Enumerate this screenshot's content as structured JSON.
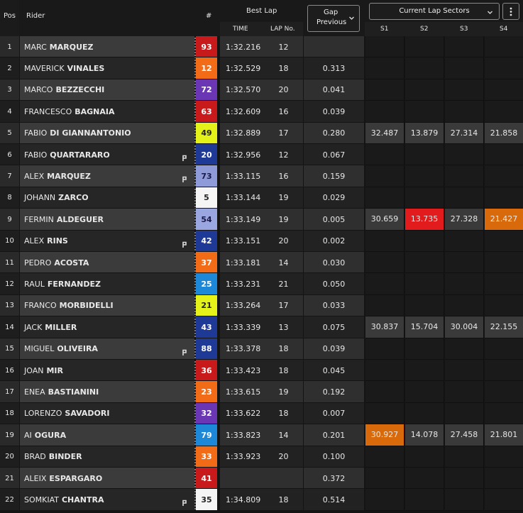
{
  "header": {
    "pos": "Pos",
    "rider": "Rider",
    "num": "#",
    "best_lap": "Best Lap",
    "time": "TIME",
    "lap_no": "LAP No.",
    "gap_previous": [
      "Gap",
      "Previous"
    ],
    "current_lap_sectors": "Current Lap Sectors",
    "sectors": [
      "S1",
      "S2",
      "S3",
      "S4"
    ]
  },
  "colors": {
    "sector_best_red": "#e21c1c",
    "sector_personal_orange": "#d96a0c"
  },
  "riders": [
    {
      "pos": "1",
      "first": "MARC",
      "last": "MARQUEZ",
      "num": "93",
      "num_bg": "#c8191b",
      "num_fg": "#ffffff",
      "time": "1:32.216",
      "lap": "12",
      "gap": "",
      "pit": false,
      "sectors": []
    },
    {
      "pos": "2",
      "first": "MAVERICK",
      "last": "VINALES",
      "num": "12",
      "num_bg": "#f26b16",
      "num_fg": "#ffffff",
      "time": "1:32.529",
      "lap": "18",
      "gap": "0.313",
      "pit": false,
      "sectors": []
    },
    {
      "pos": "3",
      "first": "MARCO",
      "last": "BEZZECCHI",
      "num": "72",
      "num_bg": "#6a36b4",
      "num_fg": "#ffffff",
      "time": "1:32.570",
      "lap": "20",
      "gap": "0.041",
      "pit": false,
      "sectors": []
    },
    {
      "pos": "4",
      "first": "FRANCESCO",
      "last": "BAGNAIA",
      "num": "63",
      "num_bg": "#c8191b",
      "num_fg": "#ffffff",
      "time": "1:32.609",
      "lap": "16",
      "gap": "0.039",
      "pit": false,
      "sectors": []
    },
    {
      "pos": "5",
      "first": "FABIO",
      "last": "DI GIANNANTONIO",
      "num": "49",
      "num_bg": "#e4f21a",
      "num_fg": "#222222",
      "time": "1:32.889",
      "lap": "17",
      "gap": "0.280",
      "pit": false,
      "sectors": [
        "32.487",
        "13.879",
        "27.314",
        "21.858"
      ],
      "sector_colors": [
        "",
        "",
        "",
        ""
      ]
    },
    {
      "pos": "6",
      "first": "FABIO",
      "last": "QUARTARARO",
      "num": "20",
      "num_bg": "#1f3a96",
      "num_fg": "#ffffff",
      "time": "1:32.956",
      "lap": "12",
      "gap": "0.067",
      "pit": true,
      "sectors": []
    },
    {
      "pos": "7",
      "first": "ALEX",
      "last": "MARQUEZ",
      "num": "73",
      "num_bg": "#8f9ad8",
      "num_fg": "#1a1a4a",
      "time": "1:33.115",
      "lap": "16",
      "gap": "0.159",
      "pit": true,
      "sectors": []
    },
    {
      "pos": "8",
      "first": "JOHANN",
      "last": "ZARCO",
      "num": "5",
      "num_bg": "#f4f4f4",
      "num_fg": "#222222",
      "time": "1:33.144",
      "lap": "19",
      "gap": "0.029",
      "pit": false,
      "sectors": []
    },
    {
      "pos": "9",
      "first": "FERMIN",
      "last": "ALDEGUER",
      "num": "54",
      "num_bg": "#9aa6e0",
      "num_fg": "#1a1a4a",
      "time": "1:33.149",
      "lap": "19",
      "gap": "0.005",
      "pit": false,
      "sectors": [
        "30.659",
        "13.735",
        "27.328",
        "21.427"
      ],
      "sector_colors": [
        "",
        "#e21c1c",
        "",
        "#d96a0c"
      ]
    },
    {
      "pos": "10",
      "first": "ALEX",
      "last": "RINS",
      "num": "42",
      "num_bg": "#1f3a96",
      "num_fg": "#ffffff",
      "time": "1:33.151",
      "lap": "20",
      "gap": "0.002",
      "pit": true,
      "sectors": []
    },
    {
      "pos": "11",
      "first": "PEDRO",
      "last": "ACOSTA",
      "num": "37",
      "num_bg": "#f26b16",
      "num_fg": "#ffffff",
      "time": "1:33.181",
      "lap": "14",
      "gap": "0.030",
      "pit": false,
      "sectors": []
    },
    {
      "pos": "12",
      "first": "RAUL",
      "last": "FERNANDEZ",
      "num": "25",
      "num_bg": "#1e88d8",
      "num_fg": "#ffffff",
      "time": "1:33.231",
      "lap": "21",
      "gap": "0.050",
      "pit": false,
      "sectors": []
    },
    {
      "pos": "13",
      "first": "FRANCO",
      "last": "MORBIDELLI",
      "num": "21",
      "num_bg": "#e4f21a",
      "num_fg": "#222222",
      "time": "1:33.264",
      "lap": "17",
      "gap": "0.033",
      "pit": false,
      "sectors": []
    },
    {
      "pos": "14",
      "first": "JACK",
      "last": "MILLER",
      "num": "43",
      "num_bg": "#1f3a96",
      "num_fg": "#ffffff",
      "time": "1:33.339",
      "lap": "13",
      "gap": "0.075",
      "pit": false,
      "sectors": [
        "30.837",
        "15.704",
        "30.004",
        "22.155"
      ],
      "sector_colors": [
        "",
        "",
        "",
        ""
      ]
    },
    {
      "pos": "15",
      "first": "MIGUEL",
      "last": "OLIVEIRA",
      "num": "88",
      "num_bg": "#1f3a96",
      "num_fg": "#ffffff",
      "time": "1:33.378",
      "lap": "18",
      "gap": "0.039",
      "pit": true,
      "sectors": []
    },
    {
      "pos": "16",
      "first": "JOAN",
      "last": "MIR",
      "num": "36",
      "num_bg": "#c8191b",
      "num_fg": "#ffffff",
      "time": "1:33.423",
      "lap": "18",
      "gap": "0.045",
      "pit": false,
      "sectors": []
    },
    {
      "pos": "17",
      "first": "ENEA",
      "last": "BASTIANINI",
      "num": "23",
      "num_bg": "#f26b16",
      "num_fg": "#ffffff",
      "time": "1:33.615",
      "lap": "19",
      "gap": "0.192",
      "pit": false,
      "sectors": []
    },
    {
      "pos": "18",
      "first": "LORENZO",
      "last": "SAVADORI",
      "num": "32",
      "num_bg": "#6a36b4",
      "num_fg": "#ffffff",
      "time": "1:33.622",
      "lap": "18",
      "gap": "0.007",
      "pit": false,
      "sectors": []
    },
    {
      "pos": "19",
      "first": "AI",
      "last": "OGURA",
      "num": "79",
      "num_bg": "#1e88d8",
      "num_fg": "#ffffff",
      "time": "1:33.823",
      "lap": "14",
      "gap": "0.201",
      "pit": false,
      "sectors": [
        "30.927",
        "14.078",
        "27.458",
        "21.801"
      ],
      "sector_colors": [
        "#d96a0c",
        "",
        "",
        ""
      ]
    },
    {
      "pos": "20",
      "first": "BRAD",
      "last": "BINDER",
      "num": "33",
      "num_bg": "#f26b16",
      "num_fg": "#ffffff",
      "time": "1:33.923",
      "lap": "20",
      "gap": "0.100",
      "pit": false,
      "sectors": []
    },
    {
      "pos": "21",
      "first": "ALEIX",
      "last": "ESPARGARO",
      "num": "41",
      "num_bg": "#c8191b",
      "num_fg": "#ffffff",
      "time": "",
      "lap": "",
      "gap": "0.372",
      "pit": false,
      "sectors": []
    },
    {
      "pos": "22",
      "first": "SOMKIAT",
      "last": "CHANTRA",
      "num": "35",
      "num_bg": "#f4f4f4",
      "num_fg": "#222222",
      "time": "1:34.809",
      "lap": "18",
      "gap": "0.514",
      "pit": true,
      "sectors": []
    }
  ]
}
